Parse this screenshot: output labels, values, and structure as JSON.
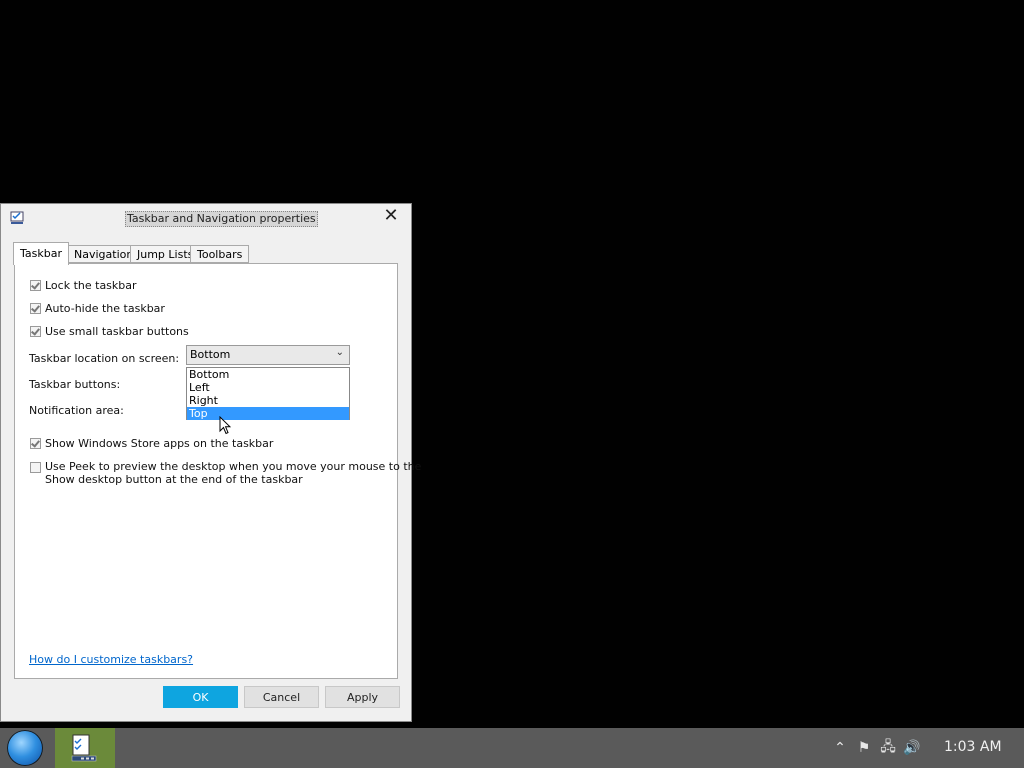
{
  "dialog": {
    "title": "Taskbar and Navigation properties",
    "close_glyph": "✕"
  },
  "tabs": [
    {
      "label": "Taskbar",
      "active": true
    },
    {
      "label": "Navigation",
      "active": false
    },
    {
      "label": "Jump Lists",
      "active": false
    },
    {
      "label": "Toolbars",
      "active": false
    }
  ],
  "taskbar_tab": {
    "lock": {
      "label": "Lock the taskbar",
      "checked": true
    },
    "autohide": {
      "label": "Auto-hide the taskbar",
      "checked": true
    },
    "small_buttons": {
      "label": "Use small taskbar buttons",
      "checked": true
    },
    "location_label": "Taskbar location on screen:",
    "location_value": "Bottom",
    "location_options": [
      "Bottom",
      "Left",
      "Right",
      "Top"
    ],
    "location_highlighted": "Top",
    "buttons_label": "Taskbar buttons:",
    "notification_label": "Notification area:",
    "store_apps": {
      "label": "Show Windows Store apps on the taskbar",
      "checked": true
    },
    "peek": {
      "label_line1": "Use Peek to preview the desktop when you move your mouse to the",
      "label_line2": "Show desktop button at the end of the taskbar",
      "checked": false
    },
    "help_link": "How do I customize taskbars?"
  },
  "buttons": {
    "ok": "OK",
    "cancel": "Cancel",
    "apply": "Apply"
  },
  "system_taskbar": {
    "tray_icons": [
      "chevron-up-icon",
      "flag-icon",
      "network-icon",
      "speaker-icon"
    ],
    "tray_glyphs": [
      "⌃",
      "⚑",
      "🖧",
      "🔊"
    ],
    "clock": "1:03 AM"
  },
  "colors": {
    "accent": "#0ea5e0",
    "selection": "#3399ff",
    "taskbar": "#5a5a5a",
    "app_tile": "#6b8a3a"
  }
}
